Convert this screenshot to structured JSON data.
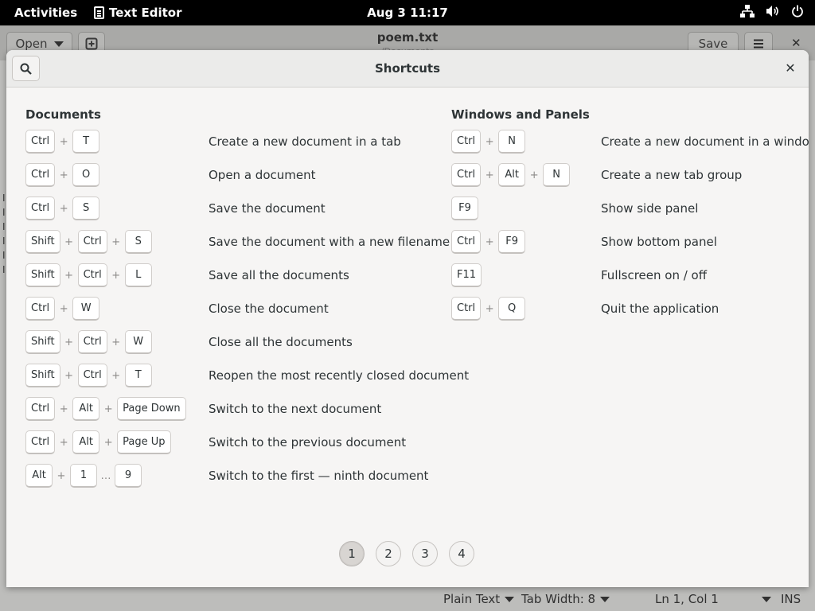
{
  "topbar": {
    "activities": "Activities",
    "app_name": "Text Editor",
    "clock": "Aug 3  11:17",
    "status_icons": [
      "network-icon",
      "volume-icon",
      "power-icon"
    ]
  },
  "background_window": {
    "open_label": "Open",
    "title": "poem.txt",
    "subtitle": "/Documents",
    "save_label": "Save",
    "statusbar": {
      "language": "Plain Text",
      "tab_width": "Tab Width: 8",
      "position": "Ln 1, Col 1",
      "mode": "INS"
    }
  },
  "dialog": {
    "title": "Shortcuts",
    "sections": [
      {
        "title": "Documents",
        "shortcuts": [
          {
            "keys": [
              "Ctrl",
              "T"
            ],
            "desc": "Create a new document in a tab"
          },
          {
            "keys": [
              "Ctrl",
              "O"
            ],
            "desc": "Open a document"
          },
          {
            "keys": [
              "Ctrl",
              "S"
            ],
            "desc": "Save the document"
          },
          {
            "keys": [
              "Shift",
              "Ctrl",
              "S"
            ],
            "desc": "Save the document with a new filename"
          },
          {
            "keys": [
              "Shift",
              "Ctrl",
              "L"
            ],
            "desc": "Save all the documents"
          },
          {
            "keys": [
              "Ctrl",
              "W"
            ],
            "desc": "Close the document"
          },
          {
            "keys": [
              "Shift",
              "Ctrl",
              "W"
            ],
            "desc": "Close all the documents"
          },
          {
            "keys": [
              "Shift",
              "Ctrl",
              "T"
            ],
            "desc": "Reopen the most recently closed document"
          },
          {
            "keys": [
              "Ctrl",
              "Alt",
              "Page Down"
            ],
            "desc": "Switch to the next document"
          },
          {
            "keys": [
              "Ctrl",
              "Alt",
              "Page Up"
            ],
            "desc": "Switch to the previous document"
          },
          {
            "keys": [
              "Alt",
              "1",
              "…",
              "9"
            ],
            "desc": "Switch to the first — ninth document"
          }
        ]
      },
      {
        "title": "Windows and Panels",
        "shortcuts": [
          {
            "keys": [
              "Ctrl",
              "N"
            ],
            "desc": "Create a new document in a window"
          },
          {
            "keys": [
              "Ctrl",
              "Alt",
              "N"
            ],
            "desc": "Create a new tab group"
          },
          {
            "keys": [
              "F9"
            ],
            "desc": "Show side panel"
          },
          {
            "keys": [
              "Ctrl",
              "F9"
            ],
            "desc": "Show bottom panel"
          },
          {
            "keys": [
              "F11"
            ],
            "desc": "Fullscreen on / off"
          },
          {
            "keys": [
              "Ctrl",
              "Q"
            ],
            "desc": "Quit the application"
          }
        ]
      }
    ],
    "pages": [
      "1",
      "2",
      "3",
      "4"
    ],
    "active_page": "1"
  }
}
